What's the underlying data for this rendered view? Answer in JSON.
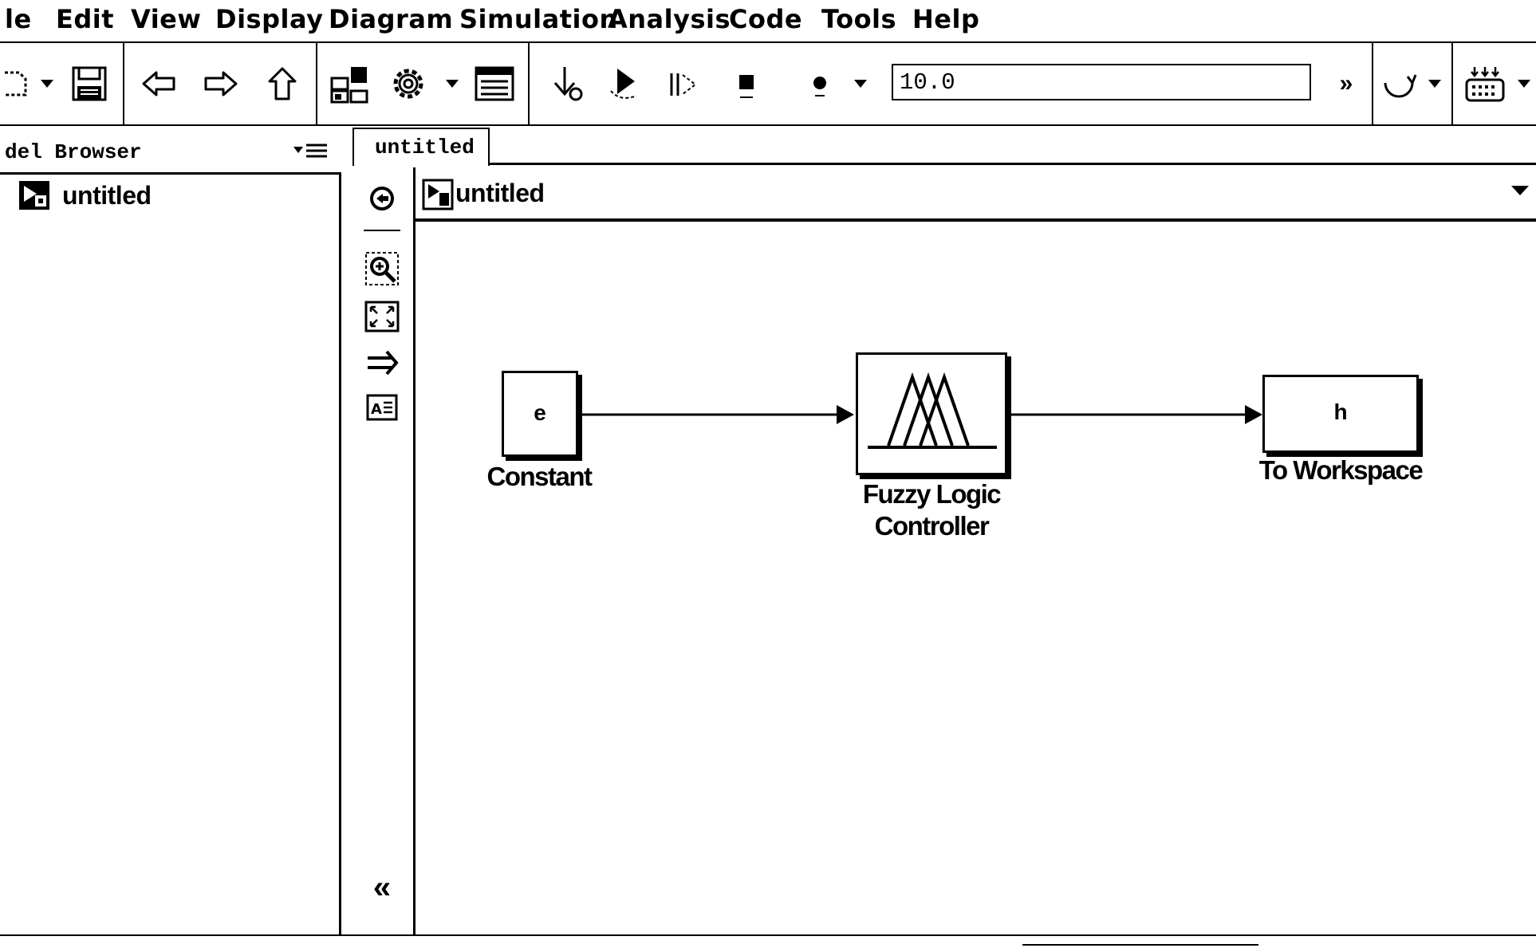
{
  "menu": [
    "le",
    "Edit",
    "View",
    "Display",
    "Diagram",
    "Simulation",
    "Analysis",
    "Code",
    "Tools",
    "Help"
  ],
  "toolbar": {
    "stop_time": "10.0",
    "more_label": "»"
  },
  "browser": {
    "title": "del Browser",
    "tree_item": "untitled"
  },
  "tab": {
    "label": "untitled"
  },
  "address": {
    "label": "untitled"
  },
  "palette": {
    "collapse_label": "«"
  },
  "blocks": {
    "constant": {
      "text": "e",
      "caption": "Constant"
    },
    "fuzzy": {
      "caption_line1": "Fuzzy Logic",
      "caption_line2": "Controller"
    },
    "workspace": {
      "text": "h",
      "caption": "To Workspace"
    }
  }
}
